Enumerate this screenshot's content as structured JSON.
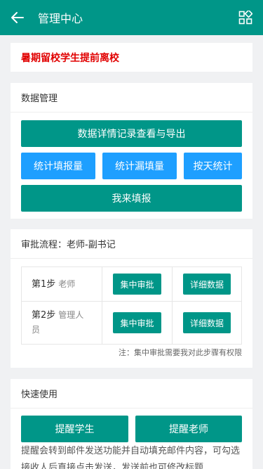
{
  "header": {
    "title": "管理中心",
    "back_icon": "arrow-left-icon",
    "menu_icon": "apps-grid-icon"
  },
  "notice": "暑期留校学生提前离校",
  "data_mgmt": {
    "title": "数据管理",
    "btn_detail": "数据详情记录查看与导出",
    "btn_filled": "统计填报量",
    "btn_missing": "统计漏填量",
    "btn_daily": "按天统计",
    "btn_report": "我来填报"
  },
  "approval": {
    "title": "审批流程：老师-副书记",
    "steps": [
      {
        "step": "第1步",
        "role": "老师",
        "action": "集中审批",
        "detail": "详细数据"
      },
      {
        "step": "第2步",
        "role": "管理人员",
        "action": "集中审批",
        "detail": "详细数据"
      }
    ],
    "note": "注：集中审批需要我对此步骤有权限"
  },
  "quick": {
    "title": "快速使用",
    "btn_students": "提醒学生",
    "btn_teachers": "提醒老师",
    "explain": "提醒会转到邮件发送功能并自动填充邮件内容，可勾选接收人后直接点击发送，发送前也可修改标题"
  },
  "colors": {
    "primary": "#009688",
    "secondary": "#1e9fff",
    "alert": "#e10000"
  }
}
